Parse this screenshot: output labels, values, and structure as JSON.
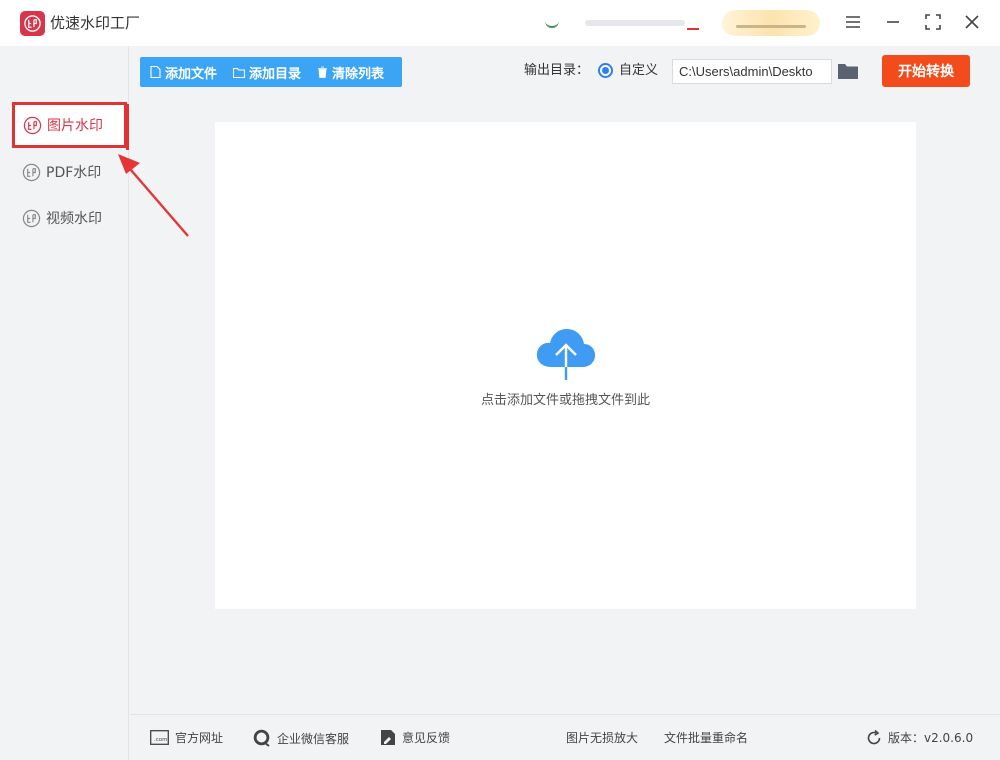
{
  "app": {
    "title": "优速水印工厂",
    "logo_icon": "seal-stamp-icon",
    "accent_color": "#d9354a"
  },
  "window_controls": {
    "menu_icon": "hamburger-icon",
    "minimize_icon": "minimize-icon",
    "maximize_icon": "fullscreen-icon",
    "close_icon": "close-icon"
  },
  "sidebar": {
    "items": [
      {
        "label": "图片水印",
        "icon": "seal-stamp-icon",
        "active": true
      },
      {
        "label": "PDF水印",
        "icon": "seal-stamp-icon",
        "active": false
      },
      {
        "label": "视频水印",
        "icon": "seal-stamp-icon",
        "active": false
      }
    ]
  },
  "toolbar": {
    "add_file": "添加文件",
    "add_folder": "添加目录",
    "clear_list": "清除列表",
    "color": "#3ba4f5"
  },
  "output": {
    "label": "输出目录：",
    "radio_label": "自定义",
    "path_value": "C:\\Users\\admin\\Deskto",
    "start_button": "开始转换",
    "start_color": "#f24c1c"
  },
  "dropzone": {
    "hint": "点击添加文件或拖拽文件到此",
    "icon": "cloud-upload-icon"
  },
  "footer": {
    "website": "官方网址",
    "wechat_support": "企业微信客服",
    "feedback": "意见反馈",
    "image_upscale": "图片无损放大",
    "batch_rename": "文件批量重命名",
    "version": "版本：v2.0.6.0"
  }
}
